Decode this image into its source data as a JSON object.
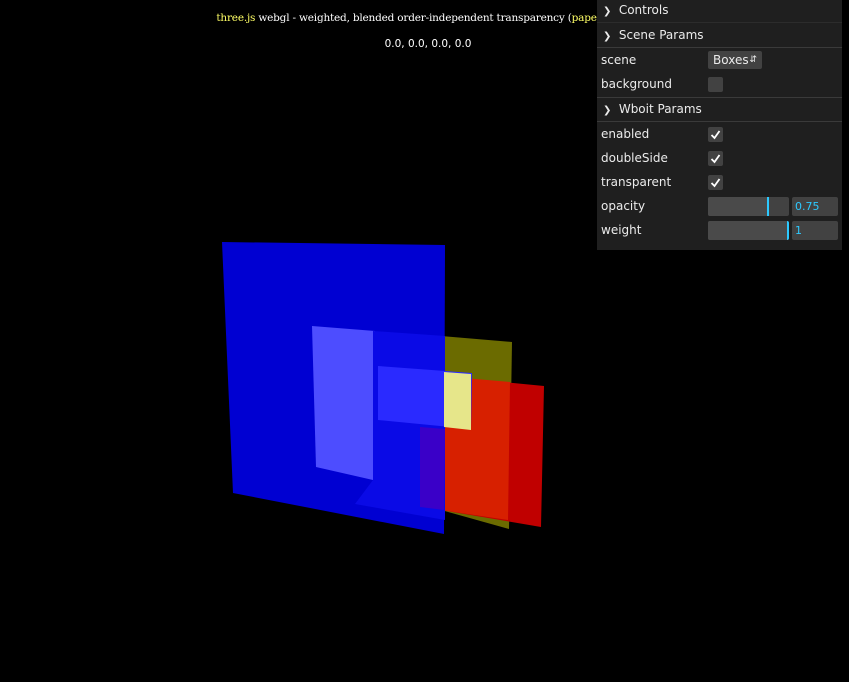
{
  "info": {
    "link": "three.js",
    "text": " webgl - weighted, blended order-independent transparency (",
    "link2": "paper",
    "tail": ","
  },
  "coords": "0.0, 0.0, 0.0, 0.0",
  "gui": {
    "title": "Controls",
    "scene_folder": {
      "title": "Scene Params",
      "scene_label": "scene",
      "scene_value": "Boxes",
      "background_label": "background",
      "background_checked": false
    },
    "wboit_folder": {
      "title": "Wboit Params",
      "enabled_label": "enabled",
      "doubleside_label": "doubleSide",
      "transparent_label": "transparent",
      "opacity_label": "opacity",
      "opacity_value": "0.75",
      "opacity_level": 0.75,
      "weight_label": "weight",
      "weight_value": "1",
      "weight_level": 1.0
    }
  },
  "colors": {
    "accent": "#2cc9ff",
    "link": "#ffff66",
    "panel": "#1f1f1f"
  }
}
